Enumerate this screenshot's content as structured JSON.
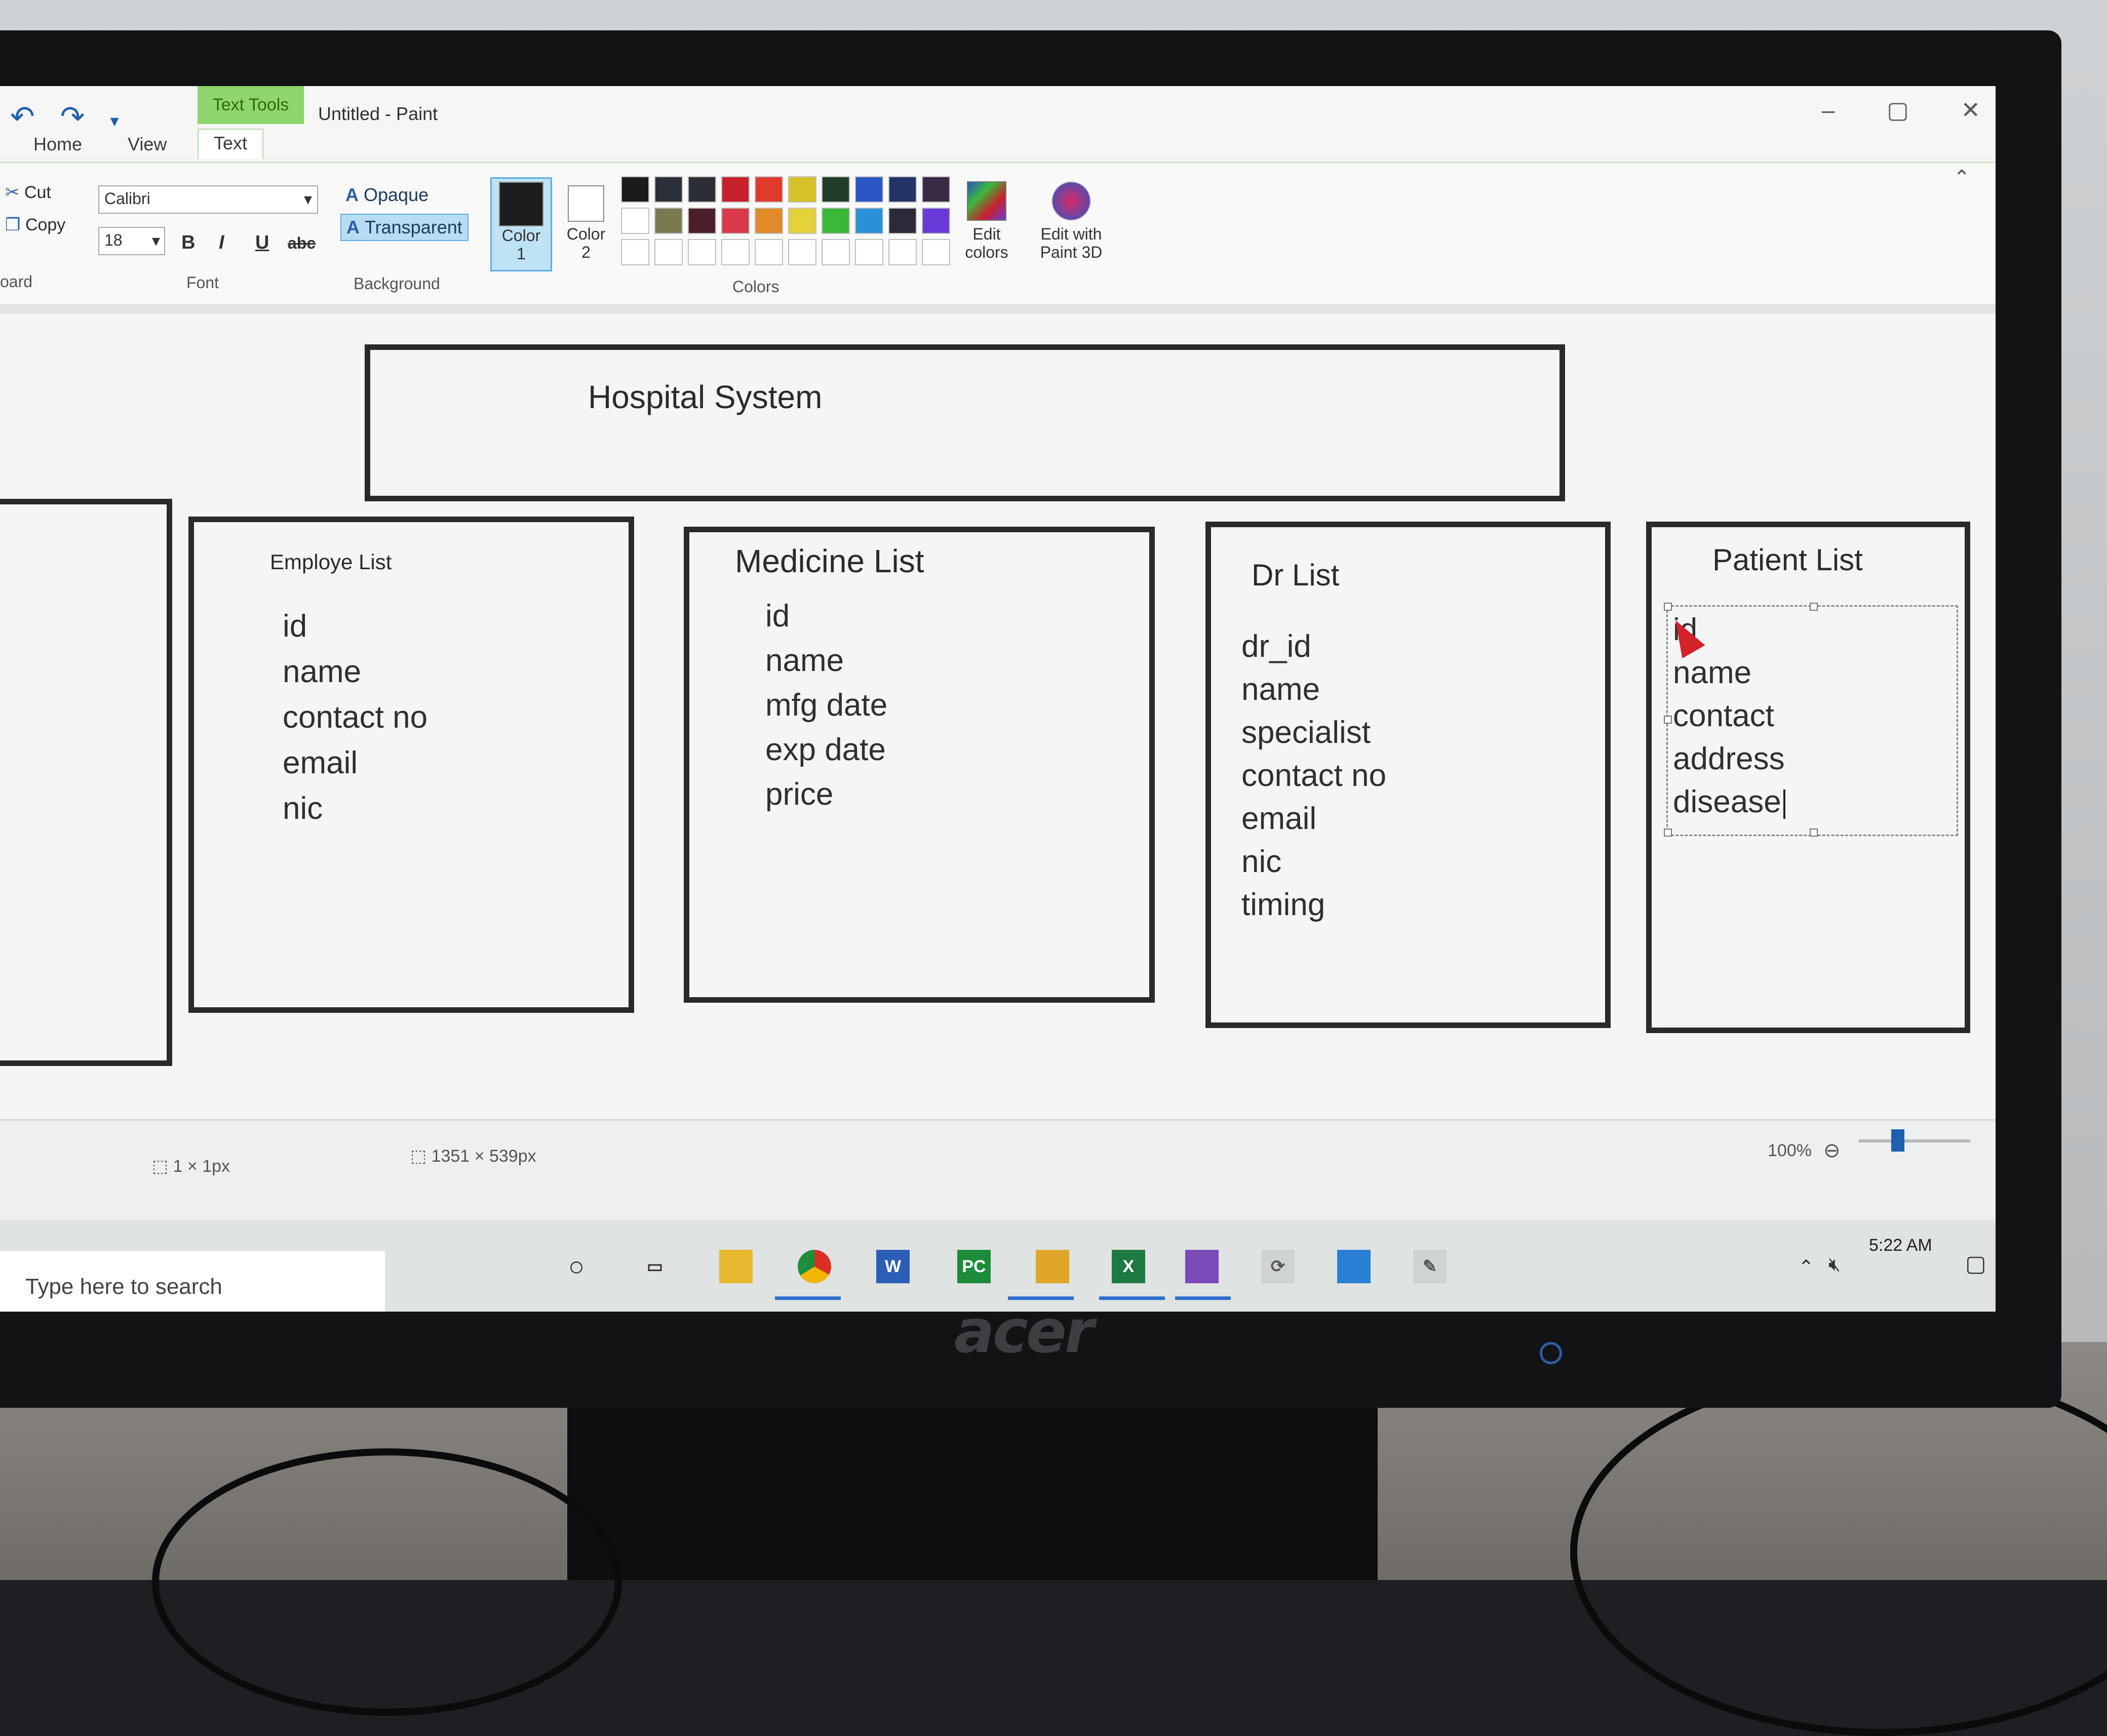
{
  "window": {
    "context_tab": "Text Tools",
    "title": "Untitled - Paint",
    "controls": {
      "minimize": "‒",
      "restore": "▢",
      "close": "✕"
    }
  },
  "tabs": [
    {
      "label": "Home"
    },
    {
      "label": "View"
    },
    {
      "label": "Text"
    }
  ],
  "ribbon": {
    "clipboard": {
      "cut": "Cut",
      "copy": "Copy",
      "group_label": "oard"
    },
    "font": {
      "family": "Calibri",
      "size": "18",
      "bold": "B",
      "italic": "I",
      "underline": "U",
      "strike": "abc",
      "group_label": "Font"
    },
    "background": {
      "opaque": "Opaque",
      "transparent": "Transparent",
      "glyph": "A",
      "group_label": "Background"
    },
    "colors": {
      "color1_label": "Color\n1",
      "color2_label": "Color\n2",
      "color1": "#1b1d1f",
      "color2": "#ffffff",
      "edit_colors": "Edit\ncolors",
      "edit_paint3d": "Edit with\nPaint 3D",
      "group_label": "Colors",
      "palette_row1": [
        "#1b1b1b",
        "#2a2f3a",
        "#2b2e36",
        "#c8202a",
        "#e03a2c",
        "#d9c12a",
        "#1f3d2a",
        "#2a55c4",
        "#223366",
        "#3a2a44"
      ],
      "palette_row2": [
        "#ffffff",
        "#7a7a52",
        "#4a1f2a",
        "#d83a4a",
        "#e08a2a",
        "#e4d23a",
        "#3ab83a",
        "#2a90d8",
        "#2a2a3a",
        "#6a3ad8"
      ]
    }
  },
  "canvas": {
    "main_title": "Hospital System",
    "employee": {
      "title": "Employe List",
      "fields": [
        "id",
        "name",
        "contact no",
        "email",
        "nic"
      ]
    },
    "medicine": {
      "title": "Medicine List",
      "fields": [
        "id",
        "name",
        "mfg date",
        "exp date",
        "price"
      ]
    },
    "doctor": {
      "title": "Dr List",
      "fields": [
        "dr_id",
        "name",
        "specialist",
        "contact no",
        "email",
        "nic",
        "timing"
      ]
    },
    "patient": {
      "title": "Patient List",
      "fields": [
        "id",
        "name",
        "contact",
        "address",
        "disease"
      ]
    }
  },
  "status": {
    "pixel_size": "1 × 1px",
    "image_size": "1351 × 539px",
    "zoom": "100%",
    "zoom_level": 0.35
  },
  "taskbar": {
    "search_placeholder": "Type here to search",
    "time": "5:22 AM"
  },
  "monitor": {
    "brand": "acer"
  }
}
